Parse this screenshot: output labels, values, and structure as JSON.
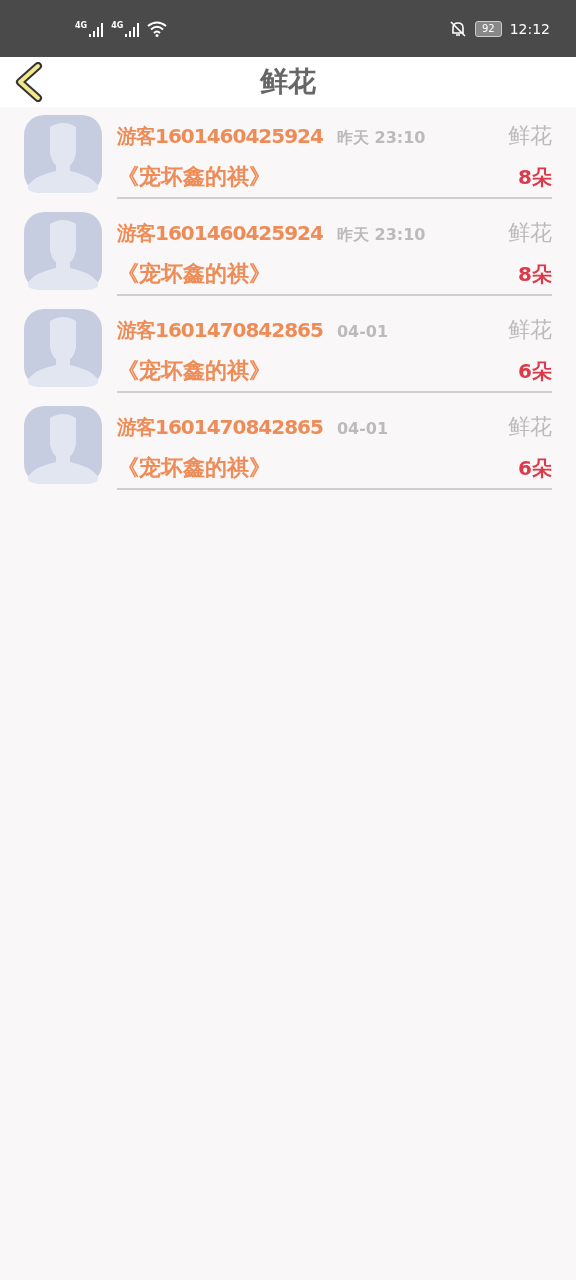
{
  "status_bar": {
    "signals": [
      "4G",
      "4G"
    ],
    "battery": "92",
    "time": "12:12"
  },
  "header": {
    "title": "鲜花"
  },
  "items": [
    {
      "user": "游客1601460425924",
      "time": "昨天 23:10",
      "book": "《宠坏鑫的祺》",
      "gift": "鲜花",
      "count": "8朵"
    },
    {
      "user": "游客1601460425924",
      "time": "昨天 23:10",
      "book": "《宠坏鑫的祺》",
      "gift": "鲜花",
      "count": "8朵"
    },
    {
      "user": "游客1601470842865",
      "time": "04-01",
      "book": "《宠坏鑫的祺》",
      "gift": "鲜花",
      "count": "6朵"
    },
    {
      "user": "游客1601470842865",
      "time": "04-01",
      "book": "《宠坏鑫的祺》",
      "gift": "鲜花",
      "count": "6朵"
    }
  ]
}
